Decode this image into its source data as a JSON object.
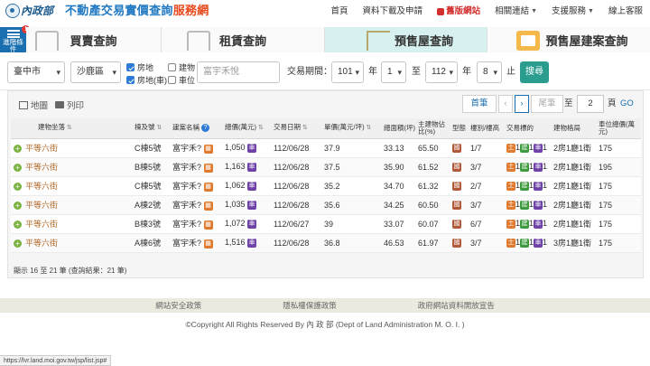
{
  "header": {
    "org": "內政部",
    "title_main": "不動產交易實價查詢",
    "title_accent": "服務網",
    "nav": [
      {
        "label": "首頁"
      },
      {
        "label": "資料下載及申請"
      },
      {
        "label": "舊版網站"
      },
      {
        "label": "相關連結"
      },
      {
        "label": "支援服務"
      },
      {
        "label": "線上客服"
      }
    ]
  },
  "side_button": {
    "label": "進階條件",
    "badge": "!"
  },
  "tabs": [
    {
      "label": "買賣查詢"
    },
    {
      "label": "租賃查詢"
    },
    {
      "label": "預售屋查詢"
    },
    {
      "label": "預售屋建案查詢"
    }
  ],
  "filter": {
    "city": "臺中市",
    "district": "沙鹿區",
    "checks": [
      {
        "label": "房地",
        "checked": true
      },
      {
        "label": "房地(車)",
        "checked": true
      },
      {
        "label": "建物",
        "checked": false
      },
      {
        "label": "車位",
        "checked": false
      }
    ],
    "keyword_placeholder": "富宇禾悅",
    "period_label": "交易期間：",
    "start_year": "101",
    "start_month": "1",
    "range_sep": "至",
    "end_year": "112",
    "end_month": "8",
    "year_unit": "年",
    "end_suffix": "止",
    "search_label": "搜尋"
  },
  "toolbar": {
    "map_label": "地圖",
    "print_label": "列印",
    "first_label": "首筆",
    "prev_label": "‹",
    "next_label": "›",
    "last_label": "尾筆",
    "goto_label": "至",
    "page_value": "2",
    "page_unit": "頁",
    "go_label": "GO"
  },
  "table": {
    "headers": [
      "建物坐落",
      "棟及號",
      "建案名稱",
      "總價(萬元)",
      "交易日期",
      "單價(萬元/坪)",
      "總面積(坪)",
      "主建物佔比(%)",
      "型態",
      "樓別/樓高",
      "交易標的",
      "建物格局",
      "車位總價(萬元)"
    ],
    "rows": [
      {
        "address": "平等六街",
        "unit": "C棟5號",
        "project": "富宇禾?",
        "total": "1,050",
        "date": "112/06/28",
        "price": "37.9",
        "area": "33.13",
        "ratio": "65.50",
        "type": "國",
        "floor": "1/7",
        "layout": "2房1廳1衛",
        "parking": "175"
      },
      {
        "address": "平等六街",
        "unit": "B棟5號",
        "project": "富宇禾?",
        "total": "1,163",
        "date": "112/06/28",
        "price": "37.5",
        "area": "35.90",
        "ratio": "61.52",
        "type": "國",
        "floor": "3/7",
        "layout": "2房1廳1衛",
        "parking": "195"
      },
      {
        "address": "平等六街",
        "unit": "C棟5號",
        "project": "富宇禾?",
        "total": "1,062",
        "date": "112/06/28",
        "price": "35.2",
        "area": "34.70",
        "ratio": "61.32",
        "type": "國",
        "floor": "2/7",
        "layout": "2房1廳1衛",
        "parking": "175"
      },
      {
        "address": "平等六街",
        "unit": "A棟2號",
        "project": "富宇禾?",
        "total": "1,035",
        "date": "112/06/28",
        "price": "35.6",
        "area": "34.25",
        "ratio": "60.50",
        "type": "國",
        "floor": "3/7",
        "layout": "2房1廳1衛",
        "parking": "175"
      },
      {
        "address": "平等六街",
        "unit": "B棟3號",
        "project": "富宇禾?",
        "total": "1,072",
        "date": "112/06/27",
        "price": "39",
        "area": "33.07",
        "ratio": "60.07",
        "type": "國",
        "floor": "6/7",
        "layout": "2房1廳1衛",
        "parking": "175"
      },
      {
        "address": "平等六街",
        "unit": "A棟6號",
        "project": "富宇禾?",
        "total": "1,516",
        "date": "112/06/28",
        "price": "36.8",
        "area": "46.53",
        "ratio": "61.97",
        "type": "國",
        "floor": "3/7",
        "layout": "3房1廳1衛",
        "parking": "175"
      }
    ],
    "tag_land": "土",
    "tag_bldg": "建",
    "tag_park": "車",
    "tag_count": "1",
    "tag_sale": "賣",
    "tag_car": "車"
  },
  "result_info": "顯示 16 至 21 筆 (查詢結果：21 筆)",
  "footer": {
    "links": [
      {
        "label": "網站安全政策"
      },
      {
        "label": "隱私權保護政策"
      },
      {
        "label": "政府網站資料開放宣告"
      }
    ],
    "copyright": "©Copyright All Rights Reserved By 內 政 部 (Dept of Land Administration M. O. I. )"
  },
  "statusbar": "https://lvr.land.moi.gov.tw/jsp/list.jsp#",
  "colors": {
    "primary": "#1a6fb0",
    "accent": "#e8491d",
    "search": "#2a9d8f",
    "active_tab": "#d6f1f0"
  }
}
